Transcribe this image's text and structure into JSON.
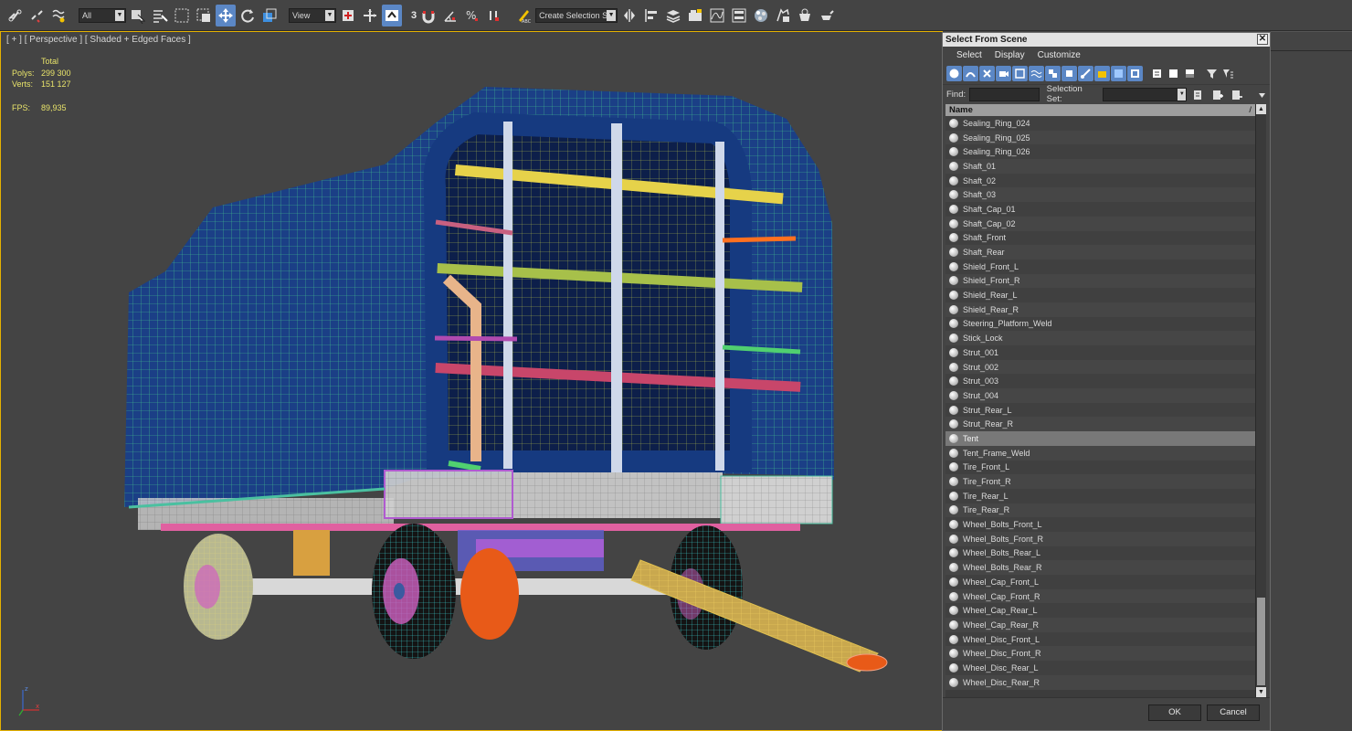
{
  "toolbar": {
    "filter_value": "All",
    "view_value": "View",
    "selection_set_placeholder": "Create Selection Se",
    "snap_label": "3"
  },
  "viewport": {
    "label": "[ + ] [ Perspective ] [ Shaded + Edged Faces ]",
    "stats": {
      "total_label": "Total",
      "polys_label": "Polys:",
      "polys_value": "299 300",
      "verts_label": "Verts:",
      "verts_value": "151 127",
      "fps_label": "FPS:",
      "fps_value": "89,935"
    },
    "axis": {
      "x": "x",
      "y": "y",
      "z": "z"
    }
  },
  "dialog": {
    "title": "Select From Scene",
    "close": "✕",
    "menu": [
      "Select",
      "Display",
      "Customize"
    ],
    "find_label": "Find:",
    "find_value": "",
    "selection_set_label": "Selection Set:",
    "column_header": "Name",
    "sort_indicator": "/",
    "items": [
      "Sealing_Ring_024",
      "Sealing_Ring_025",
      "Sealing_Ring_026",
      "Shaft_01",
      "Shaft_02",
      "Shaft_03",
      "Shaft_Cap_01",
      "Shaft_Cap_02",
      "Shaft_Front",
      "Shaft_Rear",
      "Shield_Front_L",
      "Shield_Front_R",
      "Shield_Rear_L",
      "Shield_Rear_R",
      "Steering_Platform_Weld",
      "Stick_Lock",
      "Strut_001",
      "Strut_002",
      "Strut_003",
      "Strut_004",
      "Strut_Rear_L",
      "Strut_Rear_R",
      "Tent",
      "Tent_Frame_Weld",
      "Tire_Front_L",
      "Tire_Front_R",
      "Tire_Rear_L",
      "Tire_Rear_R",
      "Wheel_Bolts_Front_L",
      "Wheel_Bolts_Front_R",
      "Wheel_Bolts_Rear_L",
      "Wheel_Bolts_Rear_R",
      "Wheel_Cap_Front_L",
      "Wheel_Cap_Front_R",
      "Wheel_Cap_Rear_L",
      "Wheel_Cap_Rear_R",
      "Wheel_Disc_Front_L",
      "Wheel_Disc_Front_R",
      "Wheel_Disc_Rear_L",
      "Wheel_Disc_Rear_R"
    ],
    "selected_item": "Tent",
    "ok_label": "OK",
    "cancel_label": "Cancel"
  },
  "colors": {
    "viewport_border": "#e4b100",
    "stats_text": "#e8e36a",
    "active_tool": "#5b87c5",
    "tent_mesh": "#1e4fa0",
    "tent_wire": "#3fd08a"
  }
}
